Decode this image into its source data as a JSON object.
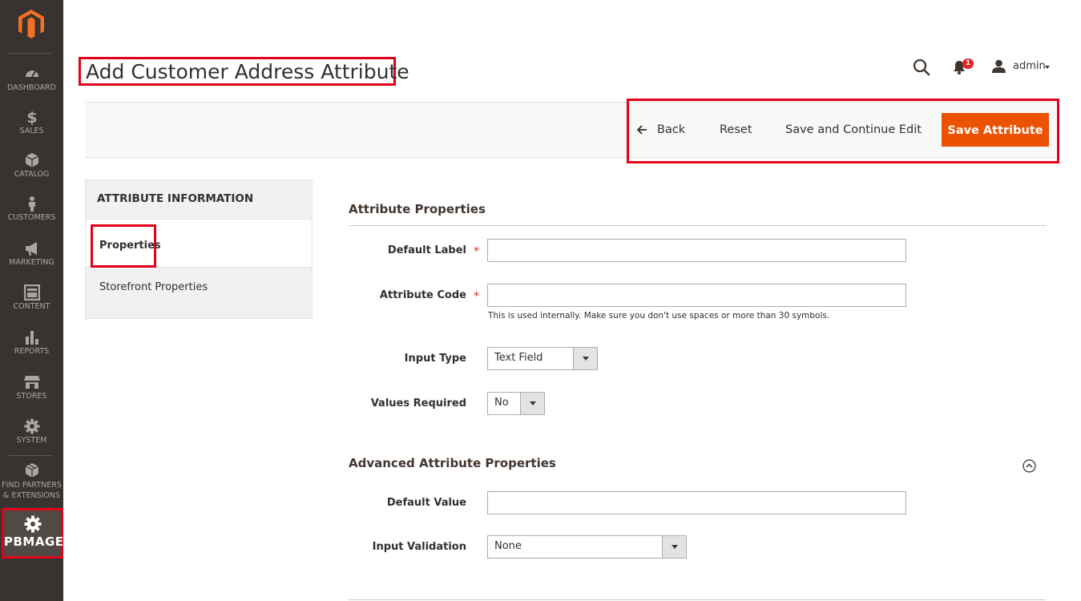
{
  "sidebar": {
    "logo": "magento-logo-icon",
    "items": [
      {
        "label": "DASHBOARD",
        "icon": "dashboard-icon"
      },
      {
        "label": "SALES",
        "icon": "dollar-icon"
      },
      {
        "label": "CATALOG",
        "icon": "box-icon"
      },
      {
        "label": "CUSTOMERS",
        "icon": "person-icon"
      },
      {
        "label": "MARKETING",
        "icon": "megaphone-icon"
      },
      {
        "label": "CONTENT",
        "icon": "layout-icon"
      },
      {
        "label": "REPORTS",
        "icon": "bar-chart-icon"
      },
      {
        "label": "STORES",
        "icon": "store-icon"
      },
      {
        "label": "SYSTEM",
        "icon": "gear-icon"
      },
      {
        "label_line1": "FIND PARTNERS",
        "label_line2": "& EXTENSIONS",
        "icon": "cubes-icon"
      }
    ],
    "pbmage": {
      "label": "PBMAGE",
      "icon": "gear-icon"
    }
  },
  "header": {
    "title": "Add Customer Address Attribute",
    "notification_count": "1",
    "user": "admin"
  },
  "actions": {
    "back": "Back",
    "reset": "Reset",
    "save_continue": "Save and Continue Edit",
    "save": "Save Attribute"
  },
  "tabs": {
    "heading": "ATTRIBUTE INFORMATION",
    "items": [
      "Properties",
      "Storefront Properties"
    ]
  },
  "form": {
    "properties_title": "Attribute Properties",
    "default_label": {
      "label": "Default Label",
      "value": ""
    },
    "attribute_code": {
      "label": "Attribute Code",
      "value": "",
      "note": "This is used internally. Make sure you don't use spaces or more than 30 symbols."
    },
    "input_type": {
      "label": "Input Type",
      "value": "Text Field"
    },
    "values_required": {
      "label": "Values Required",
      "value": "No"
    },
    "advanced_title": "Advanced Attribute Properties",
    "default_value": {
      "label": "Default Value",
      "value": ""
    },
    "input_validation": {
      "label": "Input Validation",
      "value": "None"
    }
  },
  "colors": {
    "sidebar_bg": "#373330",
    "accent": "#eb5202",
    "highlight": "#e3001b"
  }
}
